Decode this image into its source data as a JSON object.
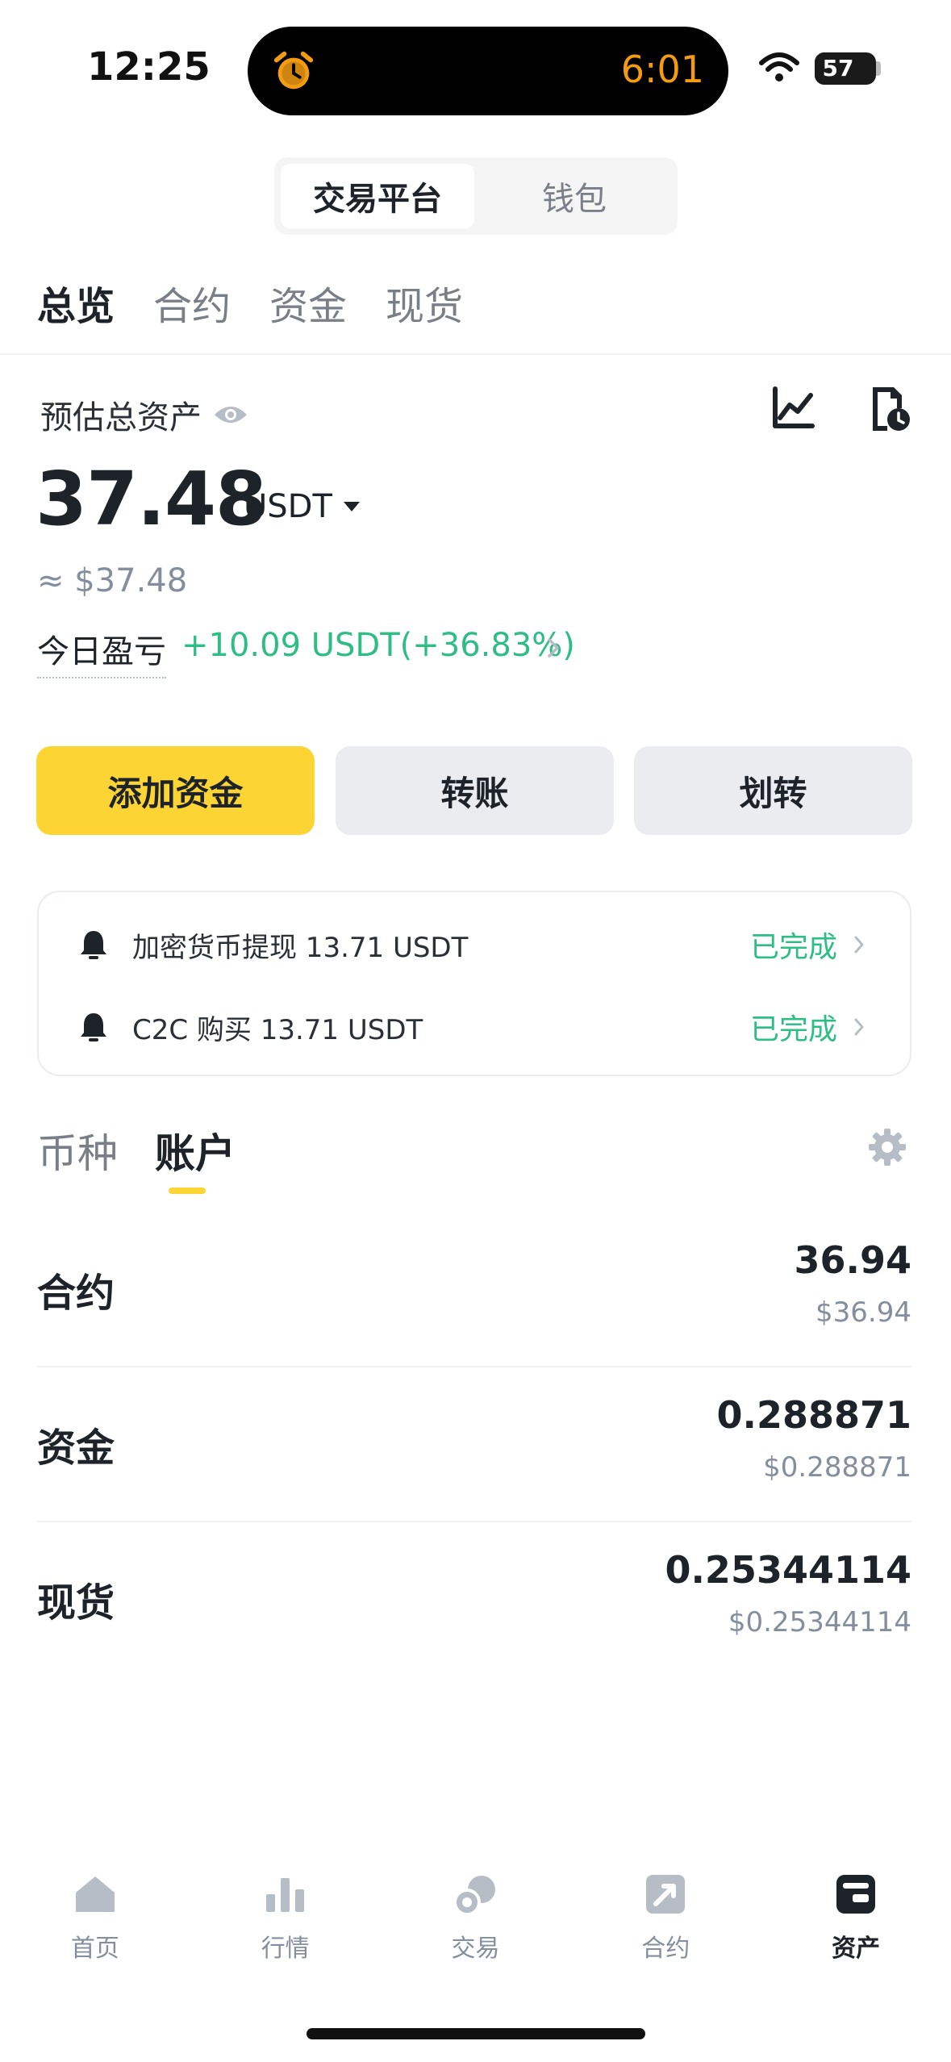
{
  "status_bar": {
    "time": "12:25",
    "timer": "6:01",
    "battery": "57"
  },
  "segment": {
    "options": [
      "交易平台",
      "钱包"
    ],
    "selected": "交易平台"
  },
  "tabs": [
    "总览",
    "合约",
    "资金",
    "现货"
  ],
  "tabs_selected": "总览",
  "summary": {
    "label": "预估总资产",
    "total": "37.48",
    "unit": "USDT",
    "fiat": "≈ $37.48",
    "pnl_label": "今日盈亏",
    "pnl_value": "+10.09 USDT(+36.83%)"
  },
  "actions": {
    "add_funds": "添加资金",
    "transfer": "转账",
    "move": "划转"
  },
  "notices": [
    {
      "text": "加密货币提现 13.71 USDT",
      "status": "已完成"
    },
    {
      "text": "C2C 购买 13.71 USDT",
      "status": "已完成"
    }
  ],
  "sub_tabs": [
    "币种",
    "账户"
  ],
  "sub_tabs_selected": "账户",
  "accounts": [
    {
      "name": "合约",
      "amount": "36.94",
      "fiat": "$36.94"
    },
    {
      "name": "资金",
      "amount": "0.288871",
      "fiat": "$0.288871"
    },
    {
      "name": "现货",
      "amount": "0.25344114",
      "fiat": "$0.25344114"
    }
  ],
  "nav": [
    {
      "label": "首页",
      "icon": "home-icon"
    },
    {
      "label": "行情",
      "icon": "bar-chart-icon"
    },
    {
      "label": "交易",
      "icon": "trade-icon"
    },
    {
      "label": "合约",
      "icon": "futures-icon"
    },
    {
      "label": "资产",
      "icon": "wallet-icon"
    }
  ],
  "nav_selected": "资产",
  "colors": {
    "accent_yellow": "#fcd535",
    "positive_green": "#2ebd85",
    "text_primary": "#1e2329",
    "text_secondary": "#848e9c",
    "timer_orange": "#f39c12"
  }
}
